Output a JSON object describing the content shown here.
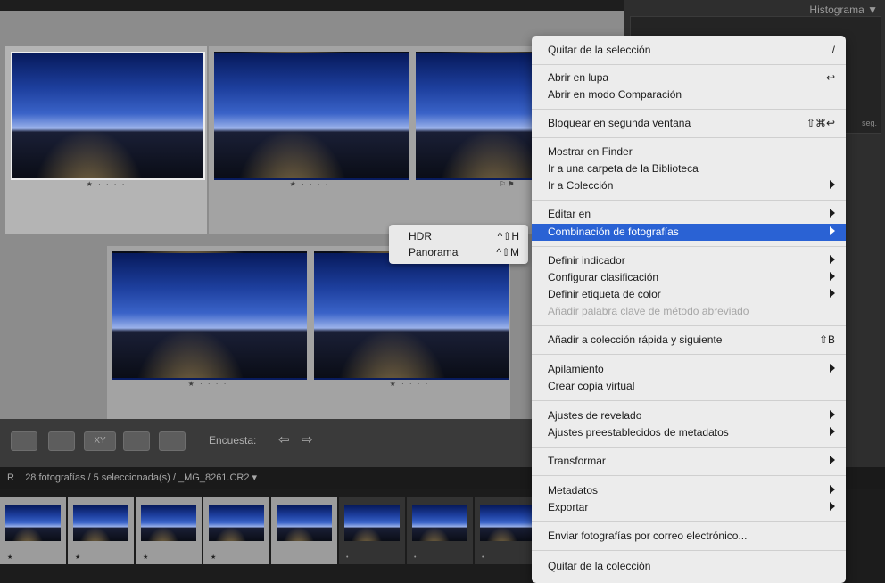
{
  "grid": {
    "cells": [
      {
        "rating": "★ · · · ·",
        "flag": ""
      },
      {
        "rating": "★ · · · ·",
        "flag": ""
      },
      {
        "rating": "★ · · · ·",
        "flag": "⚐ ⚑"
      },
      {
        "rating": "★ · · · ·",
        "flag": ""
      },
      {
        "rating": "★ · · · ·",
        "flag": ""
      }
    ]
  },
  "right_panel": {
    "histogram_title": "Histograma ▼",
    "seg_label": "seg."
  },
  "toolbar": {
    "survey_label": "Encuesta:",
    "prev_arrow": "⇦",
    "next_arrow": "⇨",
    "compare_label": "XY"
  },
  "filmstrip": {
    "info": "28 fotografías / 5 seleccionada(s) / _MG_8261.CR2 ▾",
    "left_char": "R",
    "thumbs": [
      {
        "rating": "★"
      },
      {
        "rating": "★"
      },
      {
        "rating": "★"
      },
      {
        "rating": "★"
      },
      {
        "rating": ""
      },
      {
        "rating": "•"
      },
      {
        "rating": "•"
      },
      {
        "rating": "•"
      }
    ]
  },
  "submenu": {
    "items": [
      {
        "label": "HDR",
        "shortcut": "^⇧H"
      },
      {
        "label": "Panorama",
        "shortcut": "^⇧M"
      }
    ]
  },
  "menu": {
    "items": [
      {
        "label": "Quitar de la selección",
        "shortcut": "/"
      },
      {
        "label": "Abrir en lupa",
        "shortcut": "↩"
      },
      {
        "label": "Abrir en modo Comparación",
        "shortcut": ""
      },
      {
        "label": "Bloquear en segunda ventana",
        "shortcut": "⇧⌘↩"
      },
      {
        "label": "Mostrar en Finder",
        "shortcut": ""
      },
      {
        "label": "Ir a una carpeta de la Biblioteca",
        "shortcut": ""
      },
      {
        "label": "Ir a Colección",
        "shortcut": ""
      },
      {
        "label": "Editar en",
        "shortcut": ""
      },
      {
        "label": "Combinación de fotografías",
        "shortcut": ""
      },
      {
        "label": "Definir indicador",
        "shortcut": ""
      },
      {
        "label": "Configurar clasificación",
        "shortcut": ""
      },
      {
        "label": "Definir etiqueta de color",
        "shortcut": ""
      },
      {
        "label": "Añadir palabra clave de método abreviado",
        "shortcut": ""
      },
      {
        "label": "Añadir a colección rápida y siguiente",
        "shortcut": "⇧B"
      },
      {
        "label": "Apilamiento",
        "shortcut": ""
      },
      {
        "label": "Crear copia virtual",
        "shortcut": ""
      },
      {
        "label": "Ajustes de revelado",
        "shortcut": ""
      },
      {
        "label": "Ajustes preestablecidos de metadatos",
        "shortcut": ""
      },
      {
        "label": "Transformar",
        "shortcut": ""
      },
      {
        "label": "Metadatos",
        "shortcut": ""
      },
      {
        "label": "Exportar",
        "shortcut": ""
      },
      {
        "label": "Enviar fotografías por correo electrónico...",
        "shortcut": ""
      },
      {
        "label": "Quitar de la colección",
        "shortcut": ""
      }
    ]
  },
  "colors": {
    "highlight": "#2a62d4",
    "menu_bg": "#ececec",
    "grid_bg": "#8c8c8c"
  }
}
